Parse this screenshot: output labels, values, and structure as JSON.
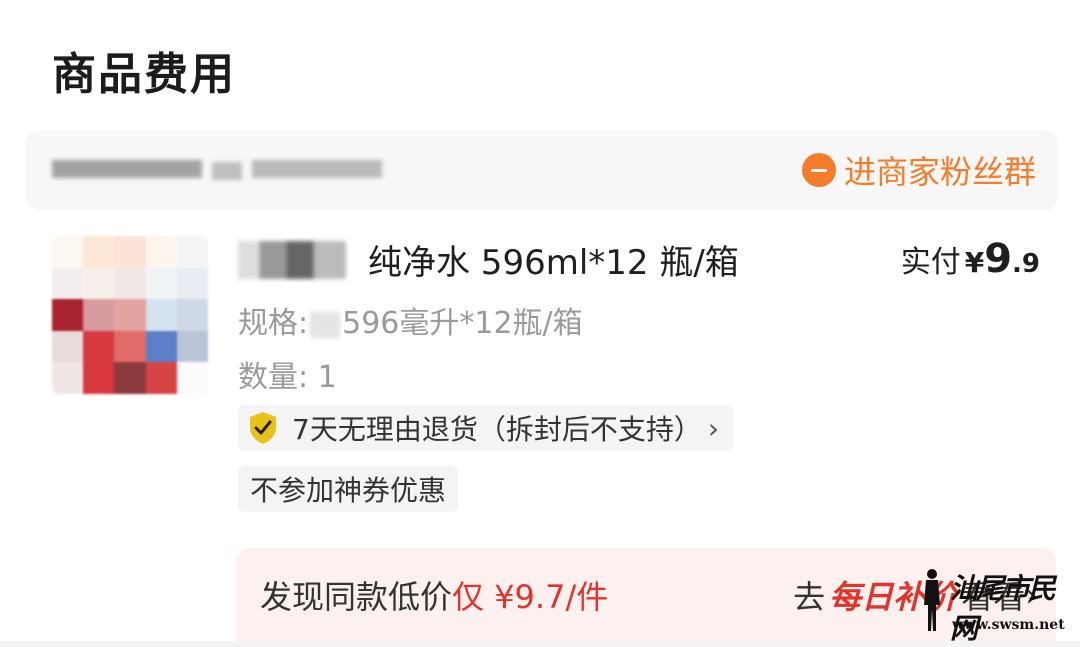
{
  "section": {
    "title": "商品费用"
  },
  "store": {
    "fan_group_label": "进商家粉丝群",
    "icon": "chat-icon"
  },
  "product": {
    "name_suffix": "纯净水 596ml*12 瓶/箱",
    "price_label": "实付",
    "price_currency": "¥",
    "price_integer": "9",
    "price_decimal": ".9",
    "spec_label": "规格:",
    "spec_value": "596毫升*12瓶/箱",
    "qty_label": "数量:",
    "qty_value": "1",
    "return_policy": "7天无理由退货（拆封后不支持）",
    "return_chevron": "›",
    "coupon_note": "不参加神券优惠"
  },
  "promo": {
    "found_prefix": "发现同款低价",
    "found_price": "仅 ¥9.7/件",
    "go_prefix": "去",
    "brand": "每日补价",
    "go_suffix": "看看",
    "chevron": "›"
  },
  "watermark": {
    "text": "汕尾市民网",
    "url": "www.swsm.net"
  },
  "colors": {
    "accent_orange": "#f47c2a",
    "accent_red": "#e2332d",
    "shield": "#e8c21a"
  }
}
